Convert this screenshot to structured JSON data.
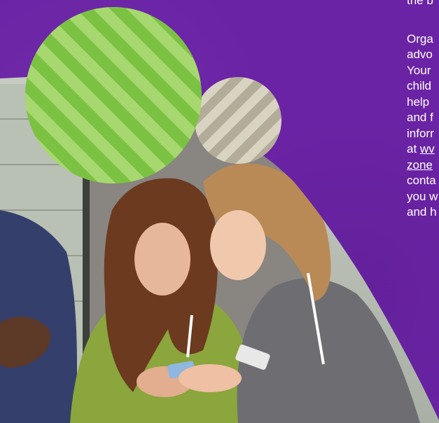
{
  "colors": {
    "background": "#6a23a5",
    "green_stripe_light": "#a6d86f",
    "green_stripe_dark": "#7cc242",
    "grey_stripe_light": "#d9d3c2",
    "grey_stripe_dark": "#b3ac99",
    "text": "#ffffff"
  },
  "side_text": {
    "line0": "the b",
    "lines": [
      "Orga",
      "advo",
      "Your",
      "child",
      "help",
      "and f",
      "inforr"
    ],
    "link_prefix": "at ",
    "link_part1": "wv",
    "link_part2": "zone",
    "lines_after": [
      "conta",
      "you w",
      "and h"
    ]
  },
  "image": {
    "description_icon": "photo-icon"
  }
}
